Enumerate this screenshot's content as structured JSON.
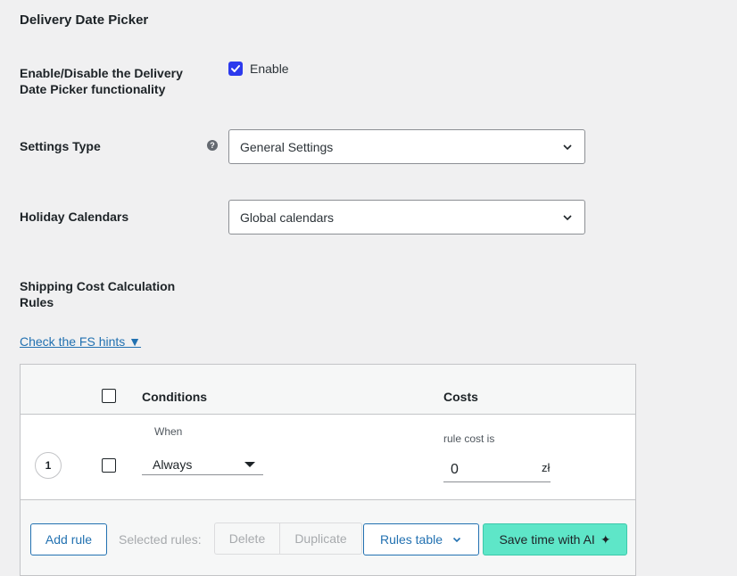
{
  "page": {
    "title": "Delivery Date Picker"
  },
  "fields": {
    "enable_label": "Enable/Disable the Delivery Date Picker functionality",
    "enable_checkbox_label": "Enable",
    "enable_checked": true,
    "settings_type_label": "Settings Type",
    "settings_type_value": "General Settings",
    "holiday_label": "Holiday Calendars",
    "holiday_value": "Global calendars",
    "shipping_label": "Shipping Cost Calculation Rules"
  },
  "hints_link": "Check the FS hints ▼",
  "table": {
    "headers": {
      "conditions": "Conditions",
      "costs": "Costs"
    },
    "rows": [
      {
        "number": "1",
        "when_label": "When",
        "condition": "Always",
        "cost_label": "rule cost is",
        "cost_value": "0",
        "currency": "zł"
      }
    ]
  },
  "footer": {
    "add_rule": "Add rule",
    "selected_rules": "Selected rules:",
    "delete": "Delete",
    "duplicate": "Duplicate",
    "rules_table": "Rules table",
    "save_ai": "Save time with AI",
    "save_ai_icon": "✦"
  },
  "colors": {
    "accent": "#2271b1",
    "checkbox": "#2c3aed",
    "ai_button": "#5ee6c8"
  }
}
